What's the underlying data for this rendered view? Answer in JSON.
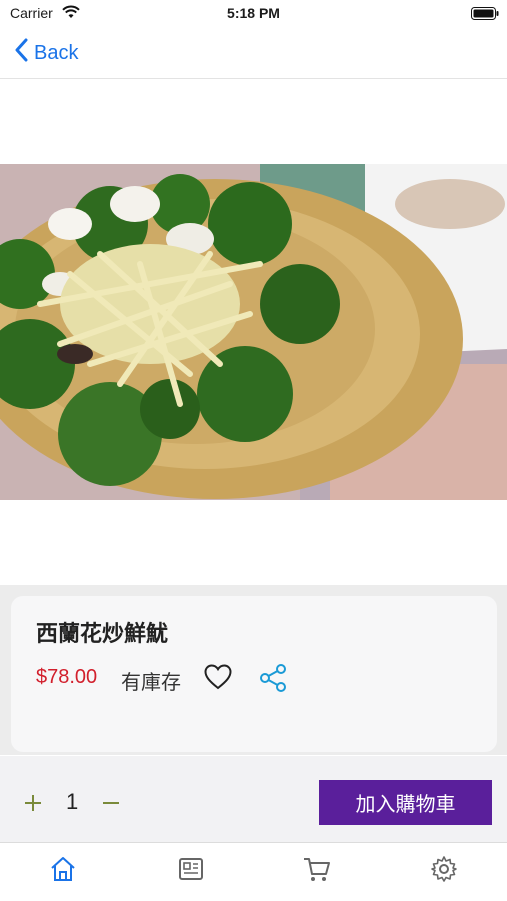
{
  "status_bar": {
    "carrier": "Carrier",
    "time": "5:18 PM"
  },
  "nav": {
    "back_label": "Back"
  },
  "product": {
    "name": "西蘭花炒鮮魷",
    "price": "$78.00",
    "stock": "有庫存",
    "image": "broccoli-squid-dish-photo"
  },
  "quantity": {
    "value": "1"
  },
  "actions": {
    "add_to_cart": "加入購物車"
  },
  "tabs": [
    {
      "icon": "home-icon",
      "active": true
    },
    {
      "icon": "news-icon",
      "active": false
    },
    {
      "icon": "cart-icon",
      "active": false
    },
    {
      "icon": "settings-icon",
      "active": false
    }
  ],
  "colors": {
    "accent": "#1a73e8",
    "price": "#d21f2c",
    "cart_button": "#5a1f9b",
    "quantity_controls": "#7a8a3a"
  }
}
